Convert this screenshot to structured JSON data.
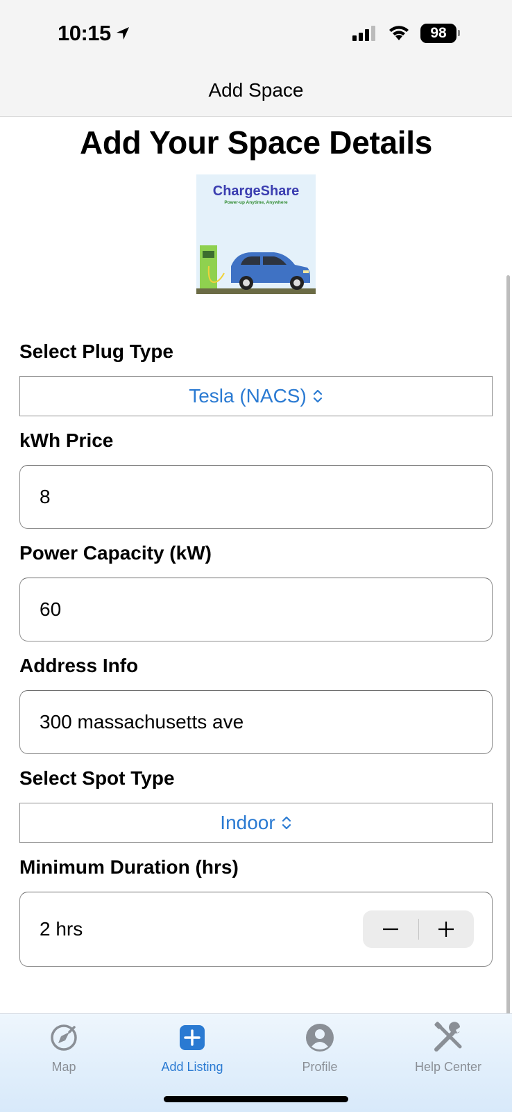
{
  "status_bar": {
    "time": "10:15",
    "battery": "98"
  },
  "nav": {
    "title": "Add Space"
  },
  "page": {
    "title": "Add Your Space Details"
  },
  "logo": {
    "brand": "ChargeShare",
    "tagline": "Power-up Anytime, Anywhere"
  },
  "form": {
    "plug_type": {
      "label": "Select Plug Type",
      "value": "Tesla (NACS)"
    },
    "kwh_price": {
      "label": "kWh Price",
      "value": "8"
    },
    "power_capacity": {
      "label": "Power Capacity (kW)",
      "value": "60"
    },
    "address": {
      "label": "Address Info",
      "value": "300 massachusetts ave"
    },
    "spot_type": {
      "label": "Select Spot Type",
      "value": "Indoor"
    },
    "min_duration": {
      "label": "Minimum Duration (hrs)",
      "value": "2 hrs"
    }
  },
  "tabs": [
    {
      "label": "Map",
      "icon": "compass-icon",
      "active": false
    },
    {
      "label": "Add Listing",
      "icon": "plus-square-icon",
      "active": true
    },
    {
      "label": "Profile",
      "icon": "person-circle-icon",
      "active": false
    },
    {
      "label": "Help Center",
      "icon": "tools-icon",
      "active": false
    }
  ],
  "colors": {
    "accent": "#2a7ad2",
    "inactive": "#8a8f96"
  }
}
